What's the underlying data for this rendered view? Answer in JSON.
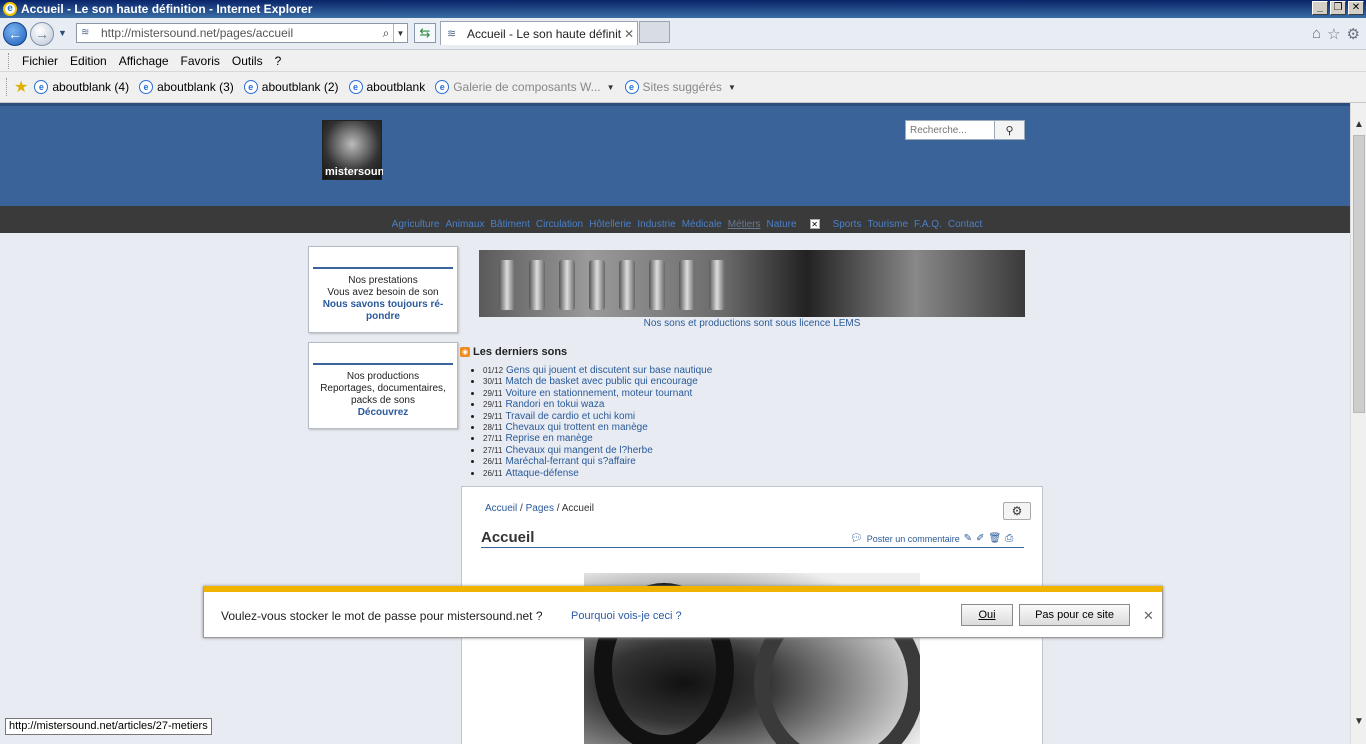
{
  "window": {
    "title": "Accueil - Le son haute définition - Internet Explorer",
    "minimize": "_",
    "restore": "❐",
    "close": "✕"
  },
  "nav": {
    "url": "http://mistersound.net/pages/accueil",
    "tab_title": "Accueil - Le son haute définit...",
    "tab_close": "✕"
  },
  "menu": [
    "Fichier",
    "Edition",
    "Affichage",
    "Favoris",
    "Outils",
    "?"
  ],
  "favorites": [
    {
      "label": "aboutblank (4)"
    },
    {
      "label": "aboutblank (3)"
    },
    {
      "label": "aboutblank (2)"
    },
    {
      "label": "aboutblank"
    },
    {
      "label": "Galerie de composants W..."
    },
    {
      "label": "Sites suggérés"
    }
  ],
  "site": {
    "logo_text": "mistersound",
    "search_placeholder": "Recherche...",
    "nav_items": [
      "Agriculture",
      "Animaux",
      "Bâtiment",
      "Circulation",
      "Hôtellerie",
      "Industrie",
      "Médicale",
      "Métiers",
      "Nature",
      "Sports",
      "Tourisme",
      "F.A.Q.",
      "Contact"
    ],
    "active_nav": "Métiers",
    "boxes": [
      {
        "l1": "Nos prestations",
        "l2": "Vous avez besoin de son",
        "l3": "Nous savons toujours ré-pondre"
      },
      {
        "l1": "Nos productions",
        "l2": "Reportages, documentaires, packs de sons",
        "l3": "Découvrez"
      }
    ],
    "banner_caption": "Nos sons et productions sont sous licence LEMS",
    "latest_title": "Les derniers sons",
    "latest_sounds": [
      {
        "date": "01/12",
        "title": "Gens qui jouent et discutent sur base nautique"
      },
      {
        "date": "30/11",
        "title": "Match de basket avec public qui encourage"
      },
      {
        "date": "29/11",
        "title": "Voiture en stationnement, moteur tournant"
      },
      {
        "date": "29/11",
        "title": "Randori en tokui waza"
      },
      {
        "date": "29/11",
        "title": "Travail de cardio et uchi komi"
      },
      {
        "date": "28/11",
        "title": "Chevaux qui trottent en manège"
      },
      {
        "date": "27/11",
        "title": "Reprise en manège"
      },
      {
        "date": "27/11",
        "title": "Chevaux qui mangent de l?herbe"
      },
      {
        "date": "26/11",
        "title": "Maréchal-ferrant qui s?affaire"
      },
      {
        "date": "26/11",
        "title": "Attaque-défense"
      }
    ],
    "breadcrumb": [
      "Accueil",
      "Pages",
      "Accueil"
    ],
    "page_title": "Accueil",
    "post_comment": "Poster un commentaire"
  },
  "password_bar": {
    "message": "Voulez-vous stocker le mot de passe pour mistersound.net ?",
    "why": "Pourquoi vois-je ceci ?",
    "yes": "Oui",
    "no": "Pas pour ce site"
  },
  "status_url": "http://mistersound.net/articles/27-metiers"
}
